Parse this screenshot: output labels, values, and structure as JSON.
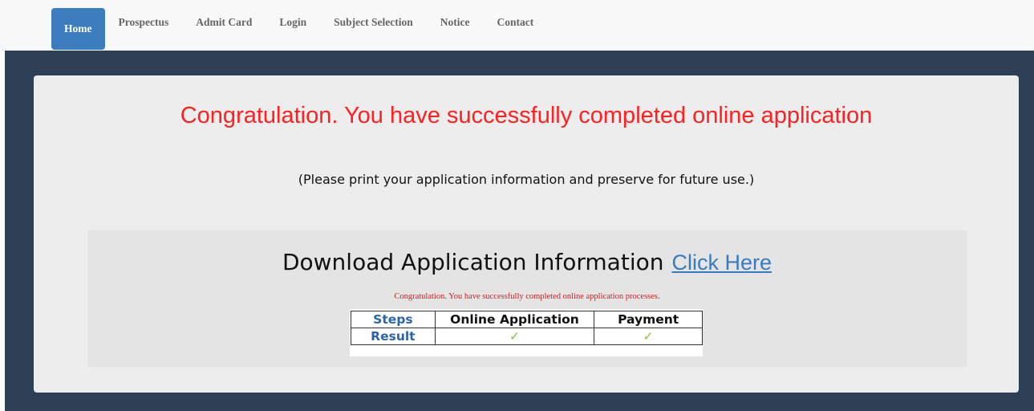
{
  "nav": {
    "items": [
      "Home",
      "Prospectus",
      "Admit Card",
      "Login",
      "Subject Selection",
      "Notice",
      "Contact"
    ],
    "active": "Home"
  },
  "main": {
    "headline": "Congratulation. You have successfully completed online application",
    "instruction": "(Please print your application information and preserve for future use.)",
    "download": {
      "label": "Download Application Information",
      "link": "Click Here"
    },
    "note": "Congratulation. You have successfully completed online application processes.",
    "table": {
      "headers": [
        "Steps",
        "Online Application",
        "Payment"
      ],
      "row_label": "Result",
      "row_values": [
        "✓",
        "✓"
      ]
    }
  },
  "colors": {
    "nav_active": "#3b7dbd",
    "main_bg": "#2d3f54",
    "headline": "#ff2020",
    "link": "#3a7bbf",
    "check": "#8bc34a"
  }
}
